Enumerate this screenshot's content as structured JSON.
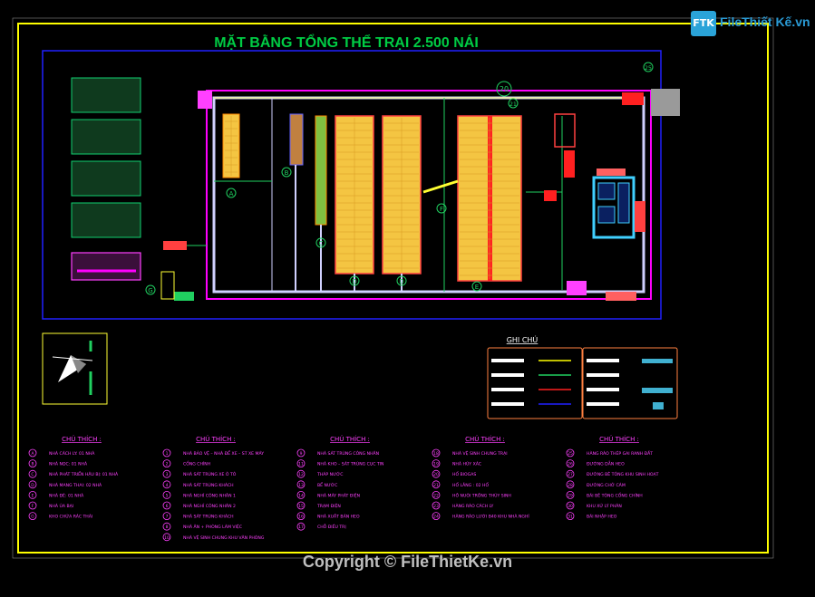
{
  "title": "MẶT BẰNG TỔNG THỂ TRẠI 2.500 NÁI",
  "logo": {
    "mark": "FTK",
    "text": "FileThiết Kế.vn"
  },
  "legend": {
    "title": "GHI CHÚ"
  },
  "colors": {
    "background": "#000000",
    "frame": "#ffff00",
    "site_border": "#2020ff",
    "title": "#00cc44",
    "barn_fill": "#f4c542",
    "corridor": "#d0d0ff",
    "wall_magenta": "#ff00ff",
    "legend_border": "#ff8040",
    "column_header": "#ff40ff"
  },
  "notes": {
    "columns": [
      {
        "header": "CHÚ THÍCH :",
        "items": [
          {
            "mark": "A",
            "text": "NHÀ CÁCH LY: 01 NHÀ"
          },
          {
            "mark": "B",
            "text": "NHÀ NỌC: 01 NHÀ"
          },
          {
            "mark": "C",
            "text": "NHÀ PHÁT TRIỂN HẬU BỊ: 01 NHÀ"
          },
          {
            "mark": "D",
            "text": "NHÀ MANG THAI: 02 NHÀ"
          },
          {
            "mark": "E",
            "text": "NHÀ ĐẺ: 01 NHÀ"
          },
          {
            "mark": "F",
            "text": "NHÀ ỦA BẠI"
          },
          {
            "mark": "G",
            "text": "KHO CHỨA RÁC THẢI"
          }
        ]
      },
      {
        "header": "CHÚ THÍCH :",
        "items": [
          {
            "mark": "1",
            "text": "NHÀ BẢO VỆ – NHÀ ĐỂ XE – ST XE MÁY"
          },
          {
            "mark": "2",
            "text": "CỔNG CHÍNH"
          },
          {
            "mark": "3",
            "text": "NHÀ SÁT TRÙNG XE Ô TÔ"
          },
          {
            "mark": "4",
            "text": "NHÀ SÁT TRÙNG KHÁCH"
          },
          {
            "mark": "5",
            "text": "NHÀ NGHỈ CÔNG NHÂN 1"
          },
          {
            "mark": "6",
            "text": "NHÀ NGHỈ CÔNG NHÂN 2"
          },
          {
            "mark": "7",
            "text": "NHÀ SÁT TRÙNG KHÁCH"
          },
          {
            "mark": "8",
            "text": "NHÀ ĂN + PHÒNG LÀM VIỆC"
          },
          {
            "mark": "10",
            "text": "NHÀ VỆ SINH CHUNG KHU VĂN PHÒNG"
          }
        ]
      },
      {
        "header": "CHÚ THÍCH :",
        "items": [
          {
            "mark": "9",
            "text": "NHÀ SÁT TRÙNG CÔNG NHÂN"
          },
          {
            "mark": "11",
            "text": "NHÀ KHO – SÁT TRÙNG CỤC TIN"
          },
          {
            "mark": "12",
            "text": "THÁP NƯỚC"
          },
          {
            "mark": "13",
            "text": "BỂ NƯỚC"
          },
          {
            "mark": "14",
            "text": "NHÀ MÁY PHÁT ĐIỆN"
          },
          {
            "mark": "15",
            "text": "TRẠM ĐIỆN"
          },
          {
            "mark": "16",
            "text": "NHÀ XUẤT BÁN HEO"
          },
          {
            "mark": "17",
            "text": "CHỖ ĐIỀU TRỊ"
          }
        ]
      },
      {
        "header": "CHÚ THÍCH :",
        "items": [
          {
            "mark": "18",
            "text": "NHÀ VỆ SINH CHUNG TRẠI"
          },
          {
            "mark": "19",
            "text": "NHÀ HỦY XÁC"
          },
          {
            "mark": "20",
            "text": "HỐ BIOGAS"
          },
          {
            "mark": "21",
            "text": "HỐ LẮNG : 02 HỐ"
          },
          {
            "mark": "22",
            "text": "HỒ NUÔI TRỒNG THỦY SINH"
          },
          {
            "mark": "23",
            "text": "HÀNG RÀO CÁCH LY"
          },
          {
            "mark": "24",
            "text": "HÀNG RÀO LƯỚI B40 KHU NHÀ NGHỈ"
          }
        ]
      },
      {
        "header": "CHÚ THÍCH :",
        "items": [
          {
            "mark": "25",
            "text": "HÀNG RÀO THÉP GAI RANH ĐẤT"
          },
          {
            "mark": "26",
            "text": "ĐƯỜNG DẪN HEO"
          },
          {
            "mark": "27",
            "text": "ĐƯỜNG BÊ TÔNG KHU SINH HOẠT"
          },
          {
            "mark": "28",
            "text": "ĐƯỜNG CHỞ CÁM"
          },
          {
            "mark": "29",
            "text": "BÃI BÊ TÔNG CỔNG CHÍNH"
          },
          {
            "mark": "30",
            "text": "KHU XỬ LÝ PHÂN"
          },
          {
            "mark": "31",
            "text": "BÃI NHẬP HEO"
          }
        ]
      }
    ]
  },
  "markers": {
    "A": "A",
    "B": "B",
    "C": "C",
    "D1": "D",
    "D2": "D",
    "E": "E",
    "F": "F",
    "G": "G",
    "n20": "20",
    "n21": "21",
    "n25": "25"
  },
  "copyright": "Copyright © FileThietKe.vn"
}
